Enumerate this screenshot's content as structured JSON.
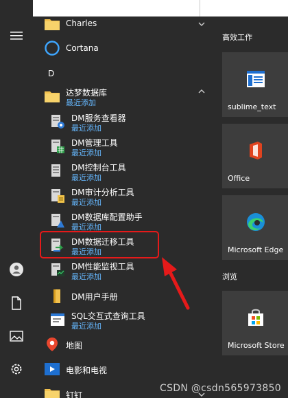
{
  "app_list": {
    "top_item": "Charles",
    "cortana": "Cortana",
    "letter_d": "D",
    "folder": {
      "name": "达梦数据库",
      "sub": "最近添加"
    },
    "items": [
      {
        "name": "DM服务查看器",
        "sub": "最近添加",
        "icon": "dm-service-viewer-icon"
      },
      {
        "name": "DM管理工具",
        "sub": "最近添加",
        "icon": "dm-manager-icon"
      },
      {
        "name": "DM控制台工具",
        "sub": "最近添加",
        "icon": "dm-console-icon"
      },
      {
        "name": "DM审计分析工具",
        "sub": "最近添加",
        "icon": "dm-audit-icon"
      },
      {
        "name": "DM数据库配置助手",
        "sub": "最近添加",
        "icon": "dm-config-assistant-icon"
      },
      {
        "name": "DM数据迁移工具",
        "sub": "最近添加",
        "icon": "dm-migration-icon"
      },
      {
        "name": "DM性能监视工具",
        "sub": "最近添加",
        "icon": "dm-monitor-icon"
      },
      {
        "name": "DM用户手册",
        "sub": "",
        "icon": "dm-manual-icon"
      },
      {
        "name": "SQL交互式查询工具",
        "sub": "最近添加",
        "icon": "sql-query-icon"
      }
    ],
    "maps": "地图",
    "movies": "电影和电视",
    "dingtalk": "钉钉"
  },
  "tiles": {
    "group1": "高效工作",
    "group2": "浏览",
    "items": [
      {
        "name": "sublime_text",
        "icon": "sublime-text-icon"
      },
      {
        "name": "Office",
        "icon": "office-icon"
      },
      {
        "name": "Microsoft Edge",
        "icon": "edge-icon"
      },
      {
        "name": "Microsoft Store",
        "icon": "store-icon"
      }
    ]
  },
  "watermark": "CSDN @csdn565973850",
  "colors": {
    "accent_text": "#66b8ff",
    "highlight": "#e51a1a",
    "bg": "#2b2b2b",
    "tile_bg": "#3d3d3d"
  }
}
